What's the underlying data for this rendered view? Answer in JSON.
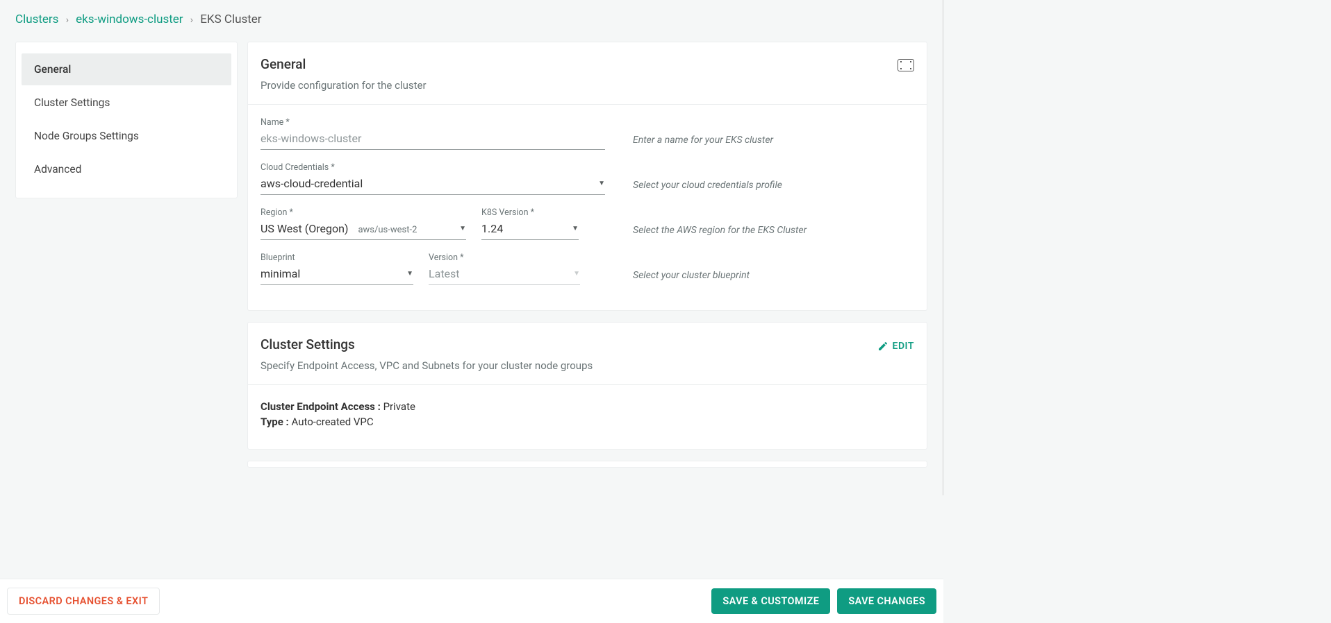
{
  "breadcrumb": {
    "root": "Clusters",
    "cluster": "eks-windows-cluster",
    "current": "EKS Cluster"
  },
  "sidebar": {
    "items": [
      {
        "label": "General",
        "active": true
      },
      {
        "label": "Cluster Settings",
        "active": false
      },
      {
        "label": "Node Groups Settings",
        "active": false
      },
      {
        "label": "Advanced",
        "active": false
      }
    ]
  },
  "general": {
    "title": "General",
    "subtitle": "Provide configuration for the cluster",
    "fields": {
      "name": {
        "label": "Name *",
        "value": "eks-windows-cluster",
        "helper": "Enter a name for your EKS cluster"
      },
      "credentials": {
        "label": "Cloud Credentials *",
        "value": "aws-cloud-credential",
        "helper": "Select your cloud credentials profile"
      },
      "region": {
        "label": "Region *",
        "value": "US West (Oregon)",
        "sub": "aws/us-west-2",
        "helper": "Select the AWS region for the EKS Cluster"
      },
      "k8s": {
        "label": "K8S Version *",
        "value": "1.24"
      },
      "blueprint": {
        "label": "Blueprint",
        "value": "minimal",
        "helper": "Select your cluster blueprint"
      },
      "bpversion": {
        "label": "Version *",
        "value": "Latest"
      }
    }
  },
  "cluster_settings": {
    "title": "Cluster Settings",
    "subtitle": "Specify Endpoint Access, VPC and Subnets for your cluster node groups",
    "edit_label": "EDIT",
    "endpoint_label": "Cluster Endpoint Access :",
    "endpoint_value": "Private",
    "type_label": "Type :",
    "type_value": "Auto-created VPC"
  },
  "footer": {
    "discard": "DISCARD CHANGES & EXIT",
    "save_customize": "SAVE & CUSTOMIZE",
    "save": "SAVE CHANGES"
  }
}
